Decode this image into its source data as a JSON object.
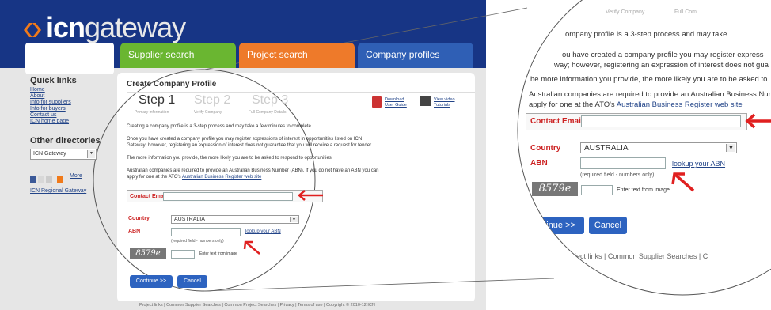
{
  "brand": {
    "bold": "icn",
    "light": "gateway"
  },
  "tabs": [
    "Supplier search",
    "Project search",
    "Company profiles"
  ],
  "sidebar": {
    "quick_links_title": "Quick links",
    "quick_links": [
      "Home",
      "About",
      "Info for suppliers",
      "Info for buyers",
      "Contact us",
      "ICN home page"
    ],
    "other_dirs_title": "Other directories",
    "directory_select": "ICN Gateway",
    "more_link": "More",
    "regional_link": "ICN Regional Gateway"
  },
  "panel": {
    "title": "Create Company Profile",
    "steps": [
      {
        "label": "Step 1",
        "sub": "Primary information"
      },
      {
        "label": "Step 2",
        "sub": "Verify Company"
      },
      {
        "label": "Step 3",
        "sub": "Full Company Details"
      }
    ],
    "download_guide": "Download User Guide",
    "video_tutorials": "View video Tutorials",
    "para1": "Creating a company profile is a 3-step process and may take a few minutes to complete.",
    "para2a": "Once you have created a company profile you may register expressions of interest in opportunities listed on ICN",
    "para2b": "Gateway; however, registering an expression of interest does not guarantee that you will receive a request for tender.",
    "para3": "The more information you provide, the more likely you are to be asked to respond to opportunities.",
    "para4a": "Australian companies are required to provide an Australian Business Number (ABN). If you do not have an ABN you can",
    "para4b": "apply for one at the ATO's ",
    "para4_link": "Australian Business Register web site",
    "contact_email_label": "Contact Email",
    "country_label": "Country",
    "country_value": "AUSTRALIA",
    "abn_label": "ABN",
    "lookup_link": "lookup your ABN",
    "abn_hint": "(required field - numbers only)",
    "captcha_text": "8579e",
    "captcha_hint": "Enter text from image",
    "continue_button": "Continue >>",
    "cancel_button": "Cancel"
  },
  "footer": "Project links | Common Supplier Searches | Common Project Searches | Privacy | Terms of use | Copyright © 2010-12 ICN",
  "zoom": {
    "steps_line_a": "Verify Company",
    "steps_line_b": "Full Com",
    "para1": "ompany profile is a 3-step process and may take",
    "para2a": "ou have created a company profile you may register express",
    "para2b": "way; however, registering an expression of interest does not gua",
    "para3": "he more information you provide, the more likely you are to be asked to",
    "para4a": "Australian companies are required to provide an Australian Business Numb",
    "para4b": "apply for one at the ATO's ",
    "para4_link": "Australian Business Register web site",
    "contact_email_label": "Contact Email",
    "country_label": "Country",
    "country_value": "AUSTRALIA",
    "abn_label": "ABN",
    "lookup_link": "lookup your ABN",
    "abn_hint": "(required field - numbers only)",
    "captcha_text": "8579e",
    "captcha_hint": "Enter text from image",
    "continue_button": "ntinue >>",
    "cancel_button": "Cancel",
    "footer": "ject links | Common Supplier Searches | C"
  },
  "colors": {
    "header_blue": "#1a3a8c",
    "tab_green": "#6ab631",
    "tab_orange": "#ee7a2a",
    "tab_blue": "#2f5fb5",
    "label_red": "#cc2222",
    "arrow_red": "#e02020",
    "button_blue": "#2d63c0"
  }
}
